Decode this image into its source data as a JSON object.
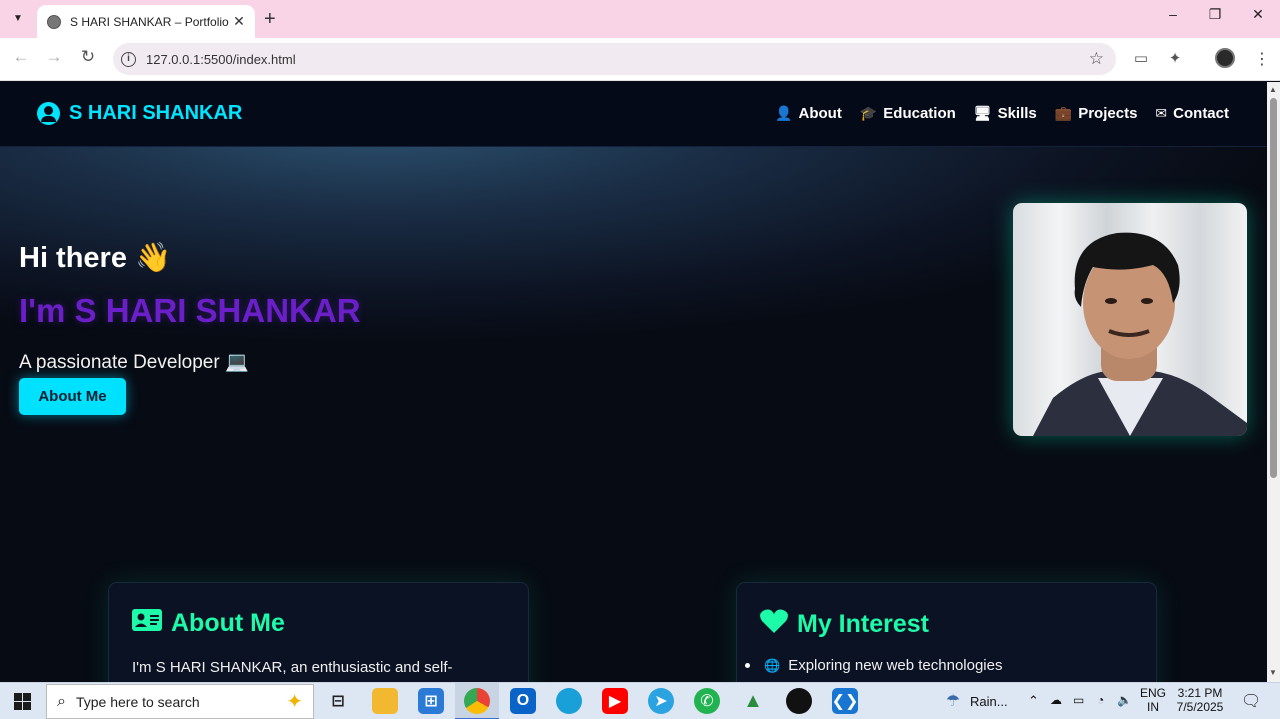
{
  "browser": {
    "tab_title": "S HARI SHANKAR – Portfolio",
    "tab_close": "✕",
    "new_tab": "+",
    "url": "127.0.0.1:5500/index.html",
    "back": "←",
    "forward": "→",
    "reload": "↻",
    "bookmark": "☆",
    "window_minimize": "–",
    "window_restore": "❐",
    "window_close": "✕",
    "menu": "⋮"
  },
  "site": {
    "brand": "S HARI SHANKAR",
    "nav": [
      {
        "label": "About",
        "icon": "user-icon",
        "glyph": "👤"
      },
      {
        "label": "Education",
        "icon": "graduation-cap-icon",
        "glyph": "🎓"
      },
      {
        "label": "Skills",
        "icon": "laptop-icon",
        "glyph": "🖥"
      },
      {
        "label": "Projects",
        "icon": "briefcase-icon",
        "glyph": "💼"
      },
      {
        "label": "Contact",
        "icon": "envelope-icon",
        "glyph": "✉"
      }
    ],
    "hero": {
      "greeting": "Hi there 👋",
      "name": "I'm S HARI SHANKAR",
      "tagline": "A passionate Developer 💻",
      "button": "About Me"
    },
    "about_card": {
      "heading": "About Me",
      "icon": "id-card-icon",
      "text": "I'm S HARI SHANKAR, an enthusiastic and self-"
    },
    "interest_card": {
      "heading": "My Interest",
      "icon": "heart-icon",
      "items": [
        "Exploring new web technologies"
      ]
    }
  },
  "taskbar": {
    "search_placeholder": "Type here to search",
    "weather": "Rain...",
    "language": "ENG",
    "region": "IN",
    "time": "3:21 PM",
    "date": "7/5/2025"
  },
  "colors": {
    "accent_cyan": "#00e5ff",
    "name_purple": "#6a1fc9",
    "card_heading_green": "#1dfba9",
    "nav_bg": "#050a19"
  }
}
